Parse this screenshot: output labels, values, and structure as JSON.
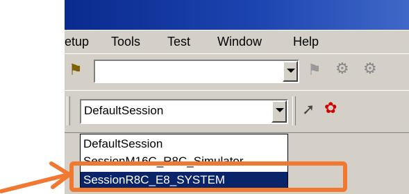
{
  "menu": {
    "setup": "etup",
    "tools": "Tools",
    "test": "Test",
    "window": "Window",
    "help": "Help"
  },
  "toolbar1": {
    "combo_value": "",
    "icons": [
      "find-icon",
      "find-in-files-icon",
      "replace-icon",
      "bookmark-icon"
    ]
  },
  "toolbar2": {
    "session_combo_value": "DefaultSession",
    "icons": [
      "connect-icon",
      "debug-session-icon"
    ]
  },
  "session_dropdown": {
    "options": [
      "DefaultSession",
      "SessionM16C_R8C_Simulator",
      "SessionR8C_E8_SYSTEM"
    ],
    "selected_index": 2
  },
  "annotation": {
    "highlight_color": "#f07830",
    "selection_color": "#0a246a"
  }
}
